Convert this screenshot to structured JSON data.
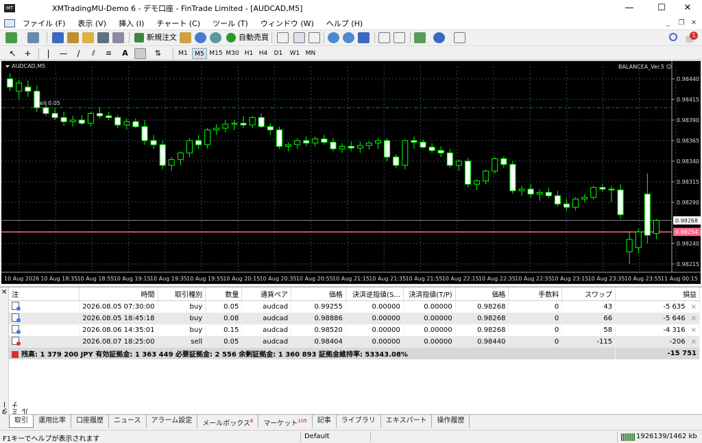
{
  "window": {
    "title": "XMTradingMU-Demo 6 - デモ口座 - FinTrade Limited - [AUDCAD,M5]",
    "logo_text": "MT",
    "minimize": "—",
    "maximize": "☐",
    "close": "✕"
  },
  "menu": {
    "items": [
      "ファイル (F)",
      "表示 (V)",
      "挿入 (I)",
      "チャート (C)",
      "ツール (T)",
      "ウィンドウ (W)",
      "ヘルプ (H)"
    ],
    "child_min": "_",
    "child_restore": "❐",
    "child_close": "✕"
  },
  "toolbar": {
    "new_order": "新規注文",
    "auto_trade": "自動売買",
    "notification_count": "1",
    "drawing_text": "A",
    "timeframes": [
      "M1",
      "M5",
      "M15",
      "M30",
      "H1",
      "H4",
      "D1",
      "W1",
      "MN"
    ],
    "active_timeframe": "M5"
  },
  "chart": {
    "symbol_label": "AUDCAD,M5",
    "ea_label": "BALANCEA_Ver.5 ☺",
    "sell_label": "sell 0.05",
    "bid_price": "0.98268",
    "line_price": "0.98254",
    "colors": {
      "background": "#000000",
      "candle": "#00ff00",
      "bull_body": "#000000",
      "bear_body": "#ffffff",
      "grid": "#3a4a5a",
      "sell_line": "#00a000",
      "order_line": "#ff6688"
    }
  },
  "chart_data": {
    "type": "candlestick",
    "y_ticks": [
      "0.98440",
      "0.98415",
      "0.98390",
      "0.98365",
      "0.98340",
      "0.98315",
      "0.98290",
      "0.98240",
      "0.98215"
    ],
    "ylim": [
      0.98205,
      0.98455
    ],
    "x_ticks": [
      "10 Aug 2026",
      "10 Aug 18:35",
      "10 Aug 18:55",
      "10 Aug 19:15",
      "10 Aug 19:35",
      "10 Aug 19:55",
      "10 Aug 20:15",
      "10 Aug 20:35",
      "10 Aug 20:55",
      "10 Aug 21:15",
      "10 Aug 21:35",
      "10 Aug 21:55",
      "10 Aug 22:15",
      "10 Aug 22:35",
      "10 Aug 22:55",
      "10 Aug 23:15",
      "10 Aug 23:35",
      "10 Aug 23:55",
      "11 Aug 00:15"
    ],
    "candles": [
      [
        0.9844,
        0.98447,
        0.98425,
        0.9843
      ],
      [
        0.98425,
        0.98438,
        0.98415,
        0.98435
      ],
      [
        0.9843,
        0.98438,
        0.98418,
        0.98425
      ],
      [
        0.98425,
        0.98432,
        0.984,
        0.98405
      ],
      [
        0.98405,
        0.98412,
        0.98395,
        0.98398
      ],
      [
        0.98398,
        0.98405,
        0.9839,
        0.98393
      ],
      [
        0.98393,
        0.984,
        0.98383,
        0.98388
      ],
      [
        0.98388,
        0.98395,
        0.98382,
        0.9839
      ],
      [
        0.9839,
        0.98396,
        0.98384,
        0.98386
      ],
      [
        0.98386,
        0.984,
        0.98382,
        0.98398
      ],
      [
        0.98398,
        0.98405,
        0.98392,
        0.98395
      ],
      [
        0.98395,
        0.984,
        0.9839,
        0.98393
      ],
      [
        0.98393,
        0.98396,
        0.9838,
        0.98384
      ],
      [
        0.98384,
        0.98392,
        0.98378,
        0.98388
      ],
      [
        0.98388,
        0.98392,
        0.9838,
        0.98382
      ],
      [
        0.98382,
        0.9839,
        0.9836,
        0.98365
      ],
      [
        0.98365,
        0.98372,
        0.98355,
        0.9836
      ],
      [
        0.9836,
        0.98365,
        0.9833,
        0.98335
      ],
      [
        0.98335,
        0.98345,
        0.98328,
        0.98342
      ],
      [
        0.98342,
        0.98352,
        0.98335,
        0.9835
      ],
      [
        0.9835,
        0.98368,
        0.98345,
        0.98365
      ],
      [
        0.98365,
        0.98372,
        0.98355,
        0.9836
      ],
      [
        0.9836,
        0.9838,
        0.98355,
        0.98378
      ],
      [
        0.98378,
        0.98385,
        0.98372,
        0.9838
      ],
      [
        0.9838,
        0.9839,
        0.98375,
        0.98385
      ],
      [
        0.98385,
        0.9839,
        0.98378,
        0.98386
      ],
      [
        0.98386,
        0.98395,
        0.9838,
        0.98384
      ],
      [
        0.98384,
        0.98395,
        0.9838,
        0.98393
      ],
      [
        0.98393,
        0.98398,
        0.9838,
        0.98382
      ],
      [
        0.98382,
        0.98386,
        0.98372,
        0.98378
      ],
      [
        0.98378,
        0.98382,
        0.98355,
        0.98358
      ],
      [
        0.98358,
        0.98363,
        0.98352,
        0.9836
      ],
      [
        0.9836,
        0.98368,
        0.98355,
        0.98365
      ],
      [
        0.98365,
        0.9837,
        0.98358,
        0.98362
      ],
      [
        0.98362,
        0.9837,
        0.98358,
        0.98367
      ],
      [
        0.98367,
        0.98372,
        0.9836,
        0.98363
      ],
      [
        0.98363,
        0.98368,
        0.98352,
        0.98355
      ],
      [
        0.98355,
        0.98362,
        0.9835,
        0.98358
      ],
      [
        0.98358,
        0.98364,
        0.98352,
        0.98356
      ],
      [
        0.98356,
        0.98364,
        0.9835,
        0.98359
      ],
      [
        0.98359,
        0.98364,
        0.98354,
        0.98362
      ],
      [
        0.98362,
        0.98368,
        0.98355,
        0.98365
      ],
      [
        0.98365,
        0.98368,
        0.9834,
        0.98345
      ],
      [
        0.98345,
        0.98348,
        0.98332,
        0.98335
      ],
      [
        0.98335,
        0.98366,
        0.9833,
        0.98365
      ],
      [
        0.98365,
        0.9837,
        0.98355,
        0.98363
      ],
      [
        0.98363,
        0.98366,
        0.98355,
        0.98357
      ],
      [
        0.98357,
        0.98362,
        0.9835,
        0.98353
      ],
      [
        0.98353,
        0.98358,
        0.98345,
        0.9835
      ],
      [
        0.9835,
        0.98355,
        0.98332,
        0.98335
      ],
      [
        0.98335,
        0.98342,
        0.98328,
        0.9834
      ],
      [
        0.9834,
        0.98344,
        0.98308,
        0.98312
      ],
      [
        0.98312,
        0.98318,
        0.98305,
        0.98316
      ],
      [
        0.98316,
        0.9833,
        0.98312,
        0.98328
      ],
      [
        0.98328,
        0.98345,
        0.98325,
        0.98343
      ],
      [
        0.98343,
        0.98346,
        0.98332,
        0.98336
      ],
      [
        0.98336,
        0.9834,
        0.983,
        0.98304
      ],
      [
        0.98304,
        0.9831,
        0.98298,
        0.98306
      ],
      [
        0.98306,
        0.98312,
        0.98296,
        0.983
      ],
      [
        0.983,
        0.98306,
        0.98292,
        0.98302
      ],
      [
        0.98302,
        0.98308,
        0.98295,
        0.98298
      ],
      [
        0.98298,
        0.98304,
        0.98285,
        0.98288
      ],
      [
        0.98288,
        0.98294,
        0.9828,
        0.98284
      ],
      [
        0.98284,
        0.98296,
        0.9828,
        0.98294
      ],
      [
        0.98294,
        0.983,
        0.9829,
        0.98296
      ],
      [
        0.98296,
        0.9831,
        0.98293,
        0.98308
      ],
      [
        0.98308,
        0.98312,
        0.98303,
        0.98306
      ],
      [
        0.98306,
        0.9831,
        0.9829,
        0.98305
      ],
      [
        0.98305,
        0.98312,
        0.9827,
        0.98275
      ],
      [
        0.9823,
        0.98255,
        0.98215,
        0.98245
      ],
      [
        0.98235,
        0.98258,
        0.98228,
        0.98254
      ],
      [
        0.983,
        0.98325,
        0.9824,
        0.9825
      ],
      [
        0.98252,
        0.9827,
        0.98245,
        0.98268
      ]
    ],
    "sell_level": 0.98405,
    "bid_level": 0.98268,
    "order_level": 0.98254
  },
  "terminal": {
    "side_label": "ターミナル",
    "close_label": "✕",
    "headers": [
      "注",
      "時間",
      "取引種別",
      "数量",
      "通貨ペア",
      "価格",
      "決済逆指値(S...",
      "決済指値(T/P)",
      "価格",
      "手数料",
      "スワップ",
      "損益"
    ],
    "rows": [
      {
        "side": "buy",
        "time": "2026.08.05 07:30:00",
        "type": "buy",
        "volume": "0.05",
        "symbol": "audcad",
        "price": "0.99255",
        "sl": "0.00000",
        "tp": "0.00000",
        "cur_price": "0.98268",
        "commission": "0",
        "swap": "43",
        "profit": "-5 635"
      },
      {
        "side": "buy",
        "time": "2026.08.05 18:45:18",
        "type": "buy",
        "volume": "0.08",
        "symbol": "audcad",
        "price": "0.98886",
        "sl": "0.00000",
        "tp": "0.00000",
        "cur_price": "0.98268",
        "commission": "0",
        "swap": "66",
        "profit": "-5 646"
      },
      {
        "side": "buy",
        "time": "2026.08.06 14:35:01",
        "type": "buy",
        "volume": "0.15",
        "symbol": "audcad",
        "price": "0.98520",
        "sl": "0.00000",
        "tp": "0.00000",
        "cur_price": "0.98268",
        "commission": "0",
        "swap": "58",
        "profit": "-4 316"
      },
      {
        "side": "sell",
        "time": "2026.08.07 18:25:00",
        "type": "sell",
        "volume": "0.05",
        "symbol": "audcad",
        "price": "0.98404",
        "sl": "0.00000",
        "tp": "0.00000",
        "cur_price": "0.98440",
        "commission": "0",
        "swap": "-115",
        "profit": "-206"
      }
    ],
    "summary": "残高: 1 379 200 JPY  有効証拠金: 1 363 449  必要証拠金: 2 556  余剰証拠金: 1 360 893  証拠金維持率: 53343.08%",
    "summary_profit": "-15 751",
    "row_close": "×"
  },
  "tabs": [
    {
      "label": "取引",
      "badge": ""
    },
    {
      "label": "運用比率",
      "badge": ""
    },
    {
      "label": "口座履歴",
      "badge": ""
    },
    {
      "label": "ニュース",
      "badge": ""
    },
    {
      "label": "アラーム設定",
      "badge": ""
    },
    {
      "label": "メールボックス",
      "badge": "6"
    },
    {
      "label": "マーケット",
      "badge": "105"
    },
    {
      "label": "記事",
      "badge": ""
    },
    {
      "label": "ライブラリ",
      "badge": ""
    },
    {
      "label": "エキスパート",
      "badge": ""
    },
    {
      "label": "操作履歴",
      "badge": ""
    }
  ],
  "status": {
    "help": "F1キーでヘルプが表示されます",
    "profile": "Default",
    "traffic": "1926139/1462 kb"
  }
}
